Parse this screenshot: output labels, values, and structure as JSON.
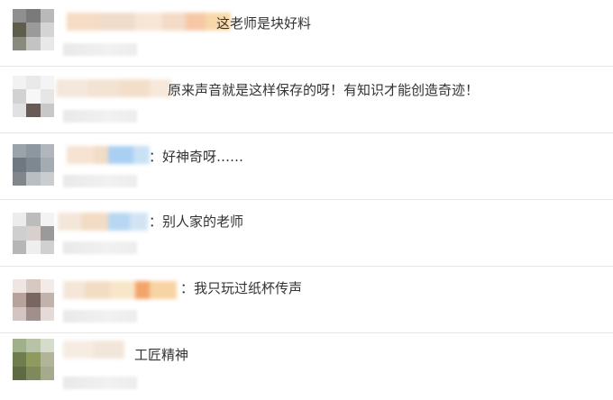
{
  "comments": [
    {
      "text": "这老师是块好料"
    },
    {
      "text": "原来声音就是这样保存的呀！有知识才能创造奇迹！"
    },
    {
      "text": "：好神奇呀……"
    },
    {
      "text": "：别人家的老师"
    },
    {
      "text": "：我只玩过纸杯传声"
    },
    {
      "text": "工匠精神"
    }
  ]
}
